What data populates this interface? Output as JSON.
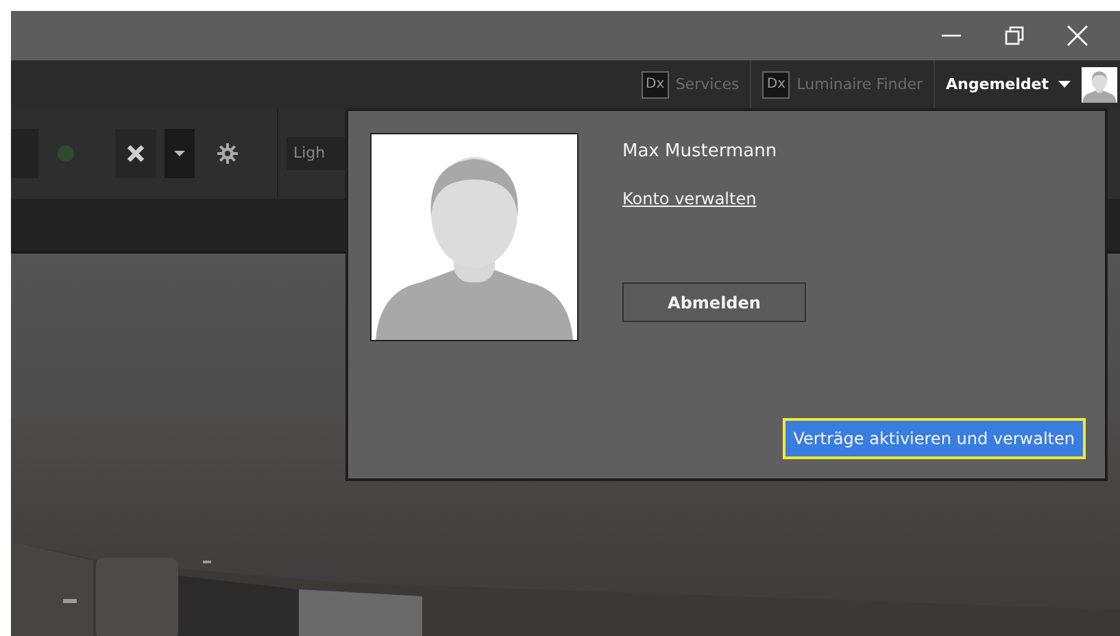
{
  "header": {
    "services": [
      {
        "badge": "Dx",
        "label": "Services"
      },
      {
        "badge": "Dx",
        "label": "Luminaire Finder"
      }
    ],
    "account": {
      "label": "Angemeldet"
    }
  },
  "toolbar": {
    "field": {
      "value": "Ligh"
    }
  },
  "account_popup": {
    "name": "Max Mustermann",
    "link": "Konto verwalten",
    "logout": "Abmelden",
    "contracts": {
      "label": "Verträge aktivieren und verwalten",
      "focused": true
    }
  }
}
